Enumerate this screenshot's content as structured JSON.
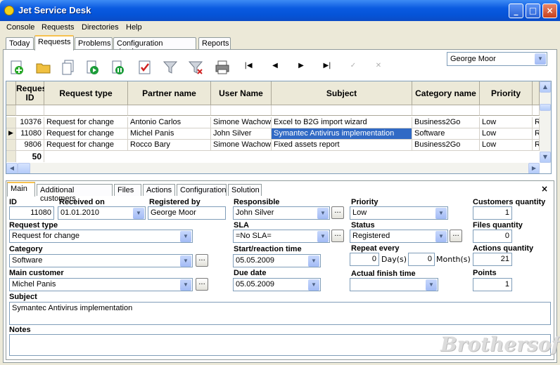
{
  "app": {
    "title": "Jet Service Desk"
  },
  "window_buttons": {
    "minimize": "_",
    "maximize": "□",
    "close": "×"
  },
  "menu": [
    "Console",
    "Requests",
    "Directories",
    "Help"
  ],
  "tabs": [
    "Today",
    "Requests",
    "Problems",
    "Configuration database",
    "Reports"
  ],
  "active_tab": "Requests",
  "toolbar": {
    "icons": [
      "add-icon",
      "open-folder-icon",
      "copy-icon",
      "play-icon",
      "pause-icon",
      "checklist-icon",
      "filter-icon",
      "clear-filter-icon",
      "print-icon"
    ],
    "nav": [
      "|◀",
      "◀",
      "▶",
      "▶|",
      "✓",
      "✕"
    ]
  },
  "user_select": {
    "value": "George Moor"
  },
  "grid": {
    "columns": [
      "Reques ID",
      "Request type",
      "Partner name",
      "User Name",
      "Subject",
      "Category name",
      "Priority"
    ],
    "rows": [
      {
        "id": "10376",
        "type": "Request for change",
        "partner": "Antonio Carlos",
        "user": "Simone Wachowski",
        "subject": "Excel to B2G import wizard",
        "category": "Business2Go",
        "priority": "Low",
        "extra": "R"
      },
      {
        "id": "11080",
        "type": "Request for change",
        "partner": "Michel Panis",
        "user": "John Silver",
        "subject": "Symantec Antivirus implementation",
        "category": "Software",
        "priority": "Low",
        "extra": "R"
      },
      {
        "id": "9806",
        "type": "Request for change",
        "partner": "Rocco Bary",
        "user": "Simone Wachowski",
        "subject": "Fixed assets report",
        "category": "Business2Go",
        "priority": "Low",
        "extra": "R"
      }
    ],
    "row_indicator": "▶",
    "count": "50"
  },
  "detail_tabs": [
    "Main",
    "Additional customers",
    "Files",
    "Actions",
    "Configuration",
    "Solution"
  ],
  "detail_close": "×",
  "form": {
    "id_label": "ID",
    "id_value": "11080",
    "received_label": "Received on",
    "received_value": "01.01.2010",
    "registered_label": "Registered by",
    "registered_value": "George Moor",
    "responsible_label": "Responsible",
    "responsible_value": "John Silver",
    "priority_label": "Priority",
    "priority_value": "Low",
    "cust_qty_label": "Customers quantity",
    "cust_qty_value": "1",
    "request_type_label": "Request type",
    "request_type_value": "Request for change",
    "sla_label": "SLA",
    "sla_value": "=No SLA=",
    "status_label": "Status",
    "status_value": "Registered",
    "files_qty_label": "Files quantity",
    "files_qty_value": "0",
    "category_label": "Category",
    "category_value": "Software",
    "start_label": "Start/reaction time",
    "start_value": "05.05.2009",
    "repeat_label": "Repeat every",
    "repeat_days_value": "0",
    "days_unit": "Day(s)",
    "repeat_months_value": "0",
    "months_unit": "Month(s)",
    "actions_qty_label": "Actions quantity",
    "actions_qty_value": "21",
    "main_customer_label": "Main customer",
    "main_customer_value": "Michel Panis",
    "due_label": "Due date",
    "due_value": "05.05.2009",
    "finish_label": "Actual finish time",
    "finish_value": "",
    "points_label": "Points",
    "points_value": "1",
    "subject_label": "Subject",
    "subject_value": "Symantec Antivirus implementation",
    "notes_label": "Notes",
    "notes_value": "",
    "dots": "..."
  },
  "watermark": "Brothersoft",
  "colors": {
    "title_bar": "#0554d8",
    "selection": "#316ac5",
    "tab_highlight": "#f7c14e"
  }
}
